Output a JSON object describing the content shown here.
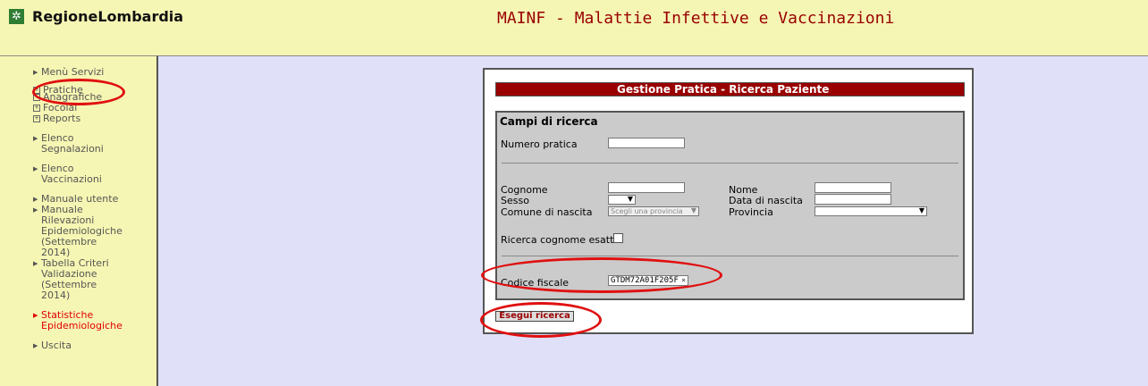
{
  "header": {
    "brand": "RegioneLombardia",
    "app_title": "MAINF - Malattie Infettive e Vaccinazioni"
  },
  "sidebar": {
    "items": [
      {
        "label": "Menù Servizi"
      },
      {
        "label": "Pratiche"
      },
      {
        "label": "Anagrafiche"
      },
      {
        "label": "Focolai"
      },
      {
        "label": "Reports"
      },
      {
        "label": "Elenco Segnalazioni"
      },
      {
        "label": "Elenco Vaccinazioni"
      },
      {
        "label": "Manuale utente"
      },
      {
        "label": "Manuale Rilevazioni Epidemiologiche (Settembre 2014)"
      },
      {
        "label": "Tabella Criteri Validazione (Settembre 2014)"
      },
      {
        "label": "Statistiche Epidemiologiche"
      },
      {
        "label": "Uscita"
      }
    ]
  },
  "form": {
    "title": "Gestione Pratica - Ricerca Paziente",
    "section_title": "Campi di ricerca",
    "numero_pratica_label": "Numero pratica",
    "numero_pratica_value": "",
    "cognome_label": "Cognome",
    "cognome_value": "",
    "nome_label": "Nome",
    "nome_value": "",
    "sesso_label": "Sesso",
    "sesso_value": "",
    "data_nascita_label": "Data di nascita",
    "data_nascita_value": "",
    "comune_label": "Comune di nascita",
    "comune_value": "Scegli una provincia",
    "provincia_label": "Provincia",
    "provincia_value": "",
    "ricerca_esatta_label": "Ricerca cognome esatta",
    "ricerca_esatta_checked": false,
    "codice_fiscale_label": "Codice fiscale",
    "codice_fiscale_value": "GTDM72A01F205F",
    "submit_label": "Esegui ricerca"
  },
  "colors": {
    "header_bg": "#f6f6b4",
    "page_bg": "#e0e0f8",
    "accent": "#990000",
    "highlight_red": "#e01010"
  }
}
